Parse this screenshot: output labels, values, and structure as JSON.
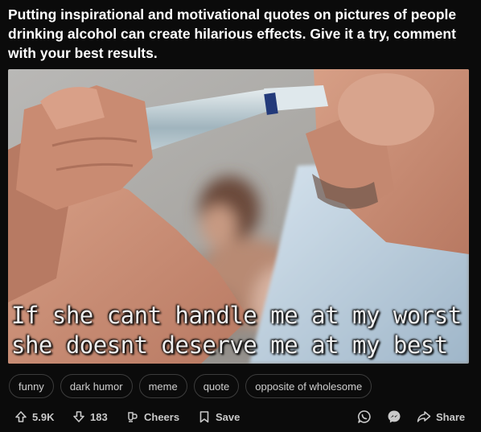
{
  "post": {
    "title": "Putting inspirational and motivational quotes on pictures of people drinking alcohol can create hilarious effects. Give it a try, comment with your best results.",
    "image": {
      "caption_line1": "If she cant handle me at my worst",
      "caption_line2": "she doesnt deserve me at my best"
    },
    "tags": [
      "funny",
      "dark humor",
      "meme",
      "quote",
      "opposite of wholesome"
    ]
  },
  "actions": {
    "upvotes": "5.9K",
    "downvotes": "183",
    "cheers_label": "Cheers",
    "save_label": "Save",
    "share_label": "Share"
  },
  "colors": {
    "background": "#0b0b0b",
    "text": "#ffffff",
    "muted_text": "#c9c9c9",
    "tag_border": "#3c3c3c"
  },
  "icons": [
    "arrow-up-icon",
    "arrow-down-icon",
    "cheers-icon",
    "bookmark-icon",
    "whatsapp-icon",
    "messenger-icon",
    "share-arrow-icon"
  ]
}
